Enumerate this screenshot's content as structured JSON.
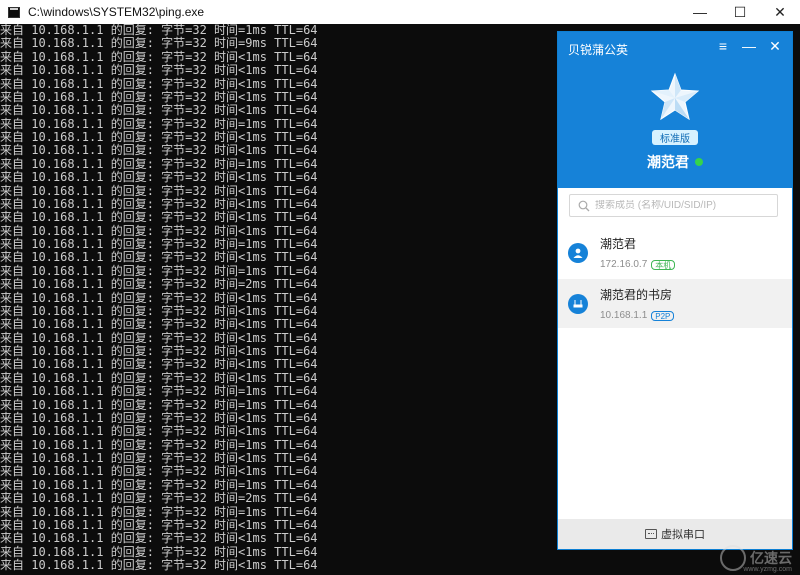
{
  "console_window": {
    "title": "C:\\windows\\SYSTEM32\\ping.exe",
    "controls": {
      "minimize": "—",
      "maximize": "☐",
      "close": "✕"
    }
  },
  "console": {
    "lines": [
      "来自 10.168.1.1 的回复: 字节=32 时间=1ms TTL=64",
      "来自 10.168.1.1 的回复: 字节=32 时间=9ms TTL=64",
      "来自 10.168.1.1 的回复: 字节=32 时间<1ms TTL=64",
      "来自 10.168.1.1 的回复: 字节=32 时间<1ms TTL=64",
      "来自 10.168.1.1 的回复: 字节=32 时间<1ms TTL=64",
      "来自 10.168.1.1 的回复: 字节=32 时间<1ms TTL=64",
      "来自 10.168.1.1 的回复: 字节=32 时间<1ms TTL=64",
      "来自 10.168.1.1 的回复: 字节=32 时间=1ms TTL=64",
      "来自 10.168.1.1 的回复: 字节=32 时间<1ms TTL=64",
      "来自 10.168.1.1 的回复: 字节=32 时间<1ms TTL=64",
      "来自 10.168.1.1 的回复: 字节=32 时间=1ms TTL=64",
      "来自 10.168.1.1 的回复: 字节=32 时间<1ms TTL=64",
      "来自 10.168.1.1 的回复: 字节=32 时间<1ms TTL=64",
      "来自 10.168.1.1 的回复: 字节=32 时间<1ms TTL=64",
      "来自 10.168.1.1 的回复: 字节=32 时间<1ms TTL=64",
      "来自 10.168.1.1 的回复: 字节=32 时间<1ms TTL=64",
      "来自 10.168.1.1 的回复: 字节=32 时间=1ms TTL=64",
      "来自 10.168.1.1 的回复: 字节=32 时间<1ms TTL=64",
      "来自 10.168.1.1 的回复: 字节=32 时间=1ms TTL=64",
      "来自 10.168.1.1 的回复: 字节=32 时间=2ms TTL=64",
      "来自 10.168.1.1 的回复: 字节=32 时间<1ms TTL=64",
      "来自 10.168.1.1 的回复: 字节=32 时间<1ms TTL=64",
      "来自 10.168.1.1 的回复: 字节=32 时间<1ms TTL=64",
      "来自 10.168.1.1 的回复: 字节=32 时间<1ms TTL=64",
      "来自 10.168.1.1 的回复: 字节=32 时间<1ms TTL=64",
      "来自 10.168.1.1 的回复: 字节=32 时间<1ms TTL=64",
      "来自 10.168.1.1 的回复: 字节=32 时间<1ms TTL=64",
      "来自 10.168.1.1 的回复: 字节=32 时间=1ms TTL=64",
      "来自 10.168.1.1 的回复: 字节=32 时间=1ms TTL=64",
      "来自 10.168.1.1 的回复: 字节=32 时间<1ms TTL=64",
      "来自 10.168.1.1 的回复: 字节=32 时间<1ms TTL=64",
      "来自 10.168.1.1 的回复: 字节=32 时间=1ms TTL=64",
      "来自 10.168.1.1 的回复: 字节=32 时间<1ms TTL=64",
      "来自 10.168.1.1 的回复: 字节=32 时间<1ms TTL=64",
      "来自 10.168.1.1 的回复: 字节=32 时间=1ms TTL=64",
      "来自 10.168.1.1 的回复: 字节=32 时间=2ms TTL=64",
      "来自 10.168.1.1 的回复: 字节=32 时间=1ms TTL=64",
      "来自 10.168.1.1 的回复: 字节=32 时间<1ms TTL=64",
      "来自 10.168.1.1 的回复: 字节=32 时间<1ms TTL=64",
      "来自 10.168.1.1 的回复: 字节=32 时间<1ms TTL=64",
      "来自 10.168.1.1 的回复: 字节=32 时间<1ms TTL=64"
    ]
  },
  "vpn_panel": {
    "title": "贝锐蒲公英",
    "controls": {
      "menu": "≡",
      "minimize": "—",
      "close": "✕"
    },
    "edition_badge": "标准版",
    "user_name": "潮范君",
    "search_placeholder": "搜索成员 (名称/UID/SID/IP)",
    "members": [
      {
        "name": "潮范君",
        "ip": "172.16.0.7",
        "tag": "本机"
      },
      {
        "name": "潮范君的书房",
        "ip": "10.168.1.1",
        "tag": "P2P"
      }
    ],
    "footer_label": "虚拟串口"
  },
  "watermark": {
    "text": "亿速云",
    "url": "www.yzmg.com"
  },
  "colors": {
    "panel_blue": "#1682d8",
    "online_green": "#35d34b",
    "local_tag_green": "#3eb654",
    "console_bg": "#0c0c0c",
    "console_text": "#cccccc"
  },
  "icons": [
    "cmd-app-icon",
    "star-logo-icon",
    "search-icon",
    "user-icon",
    "router-icon",
    "serial-port-icon"
  ]
}
